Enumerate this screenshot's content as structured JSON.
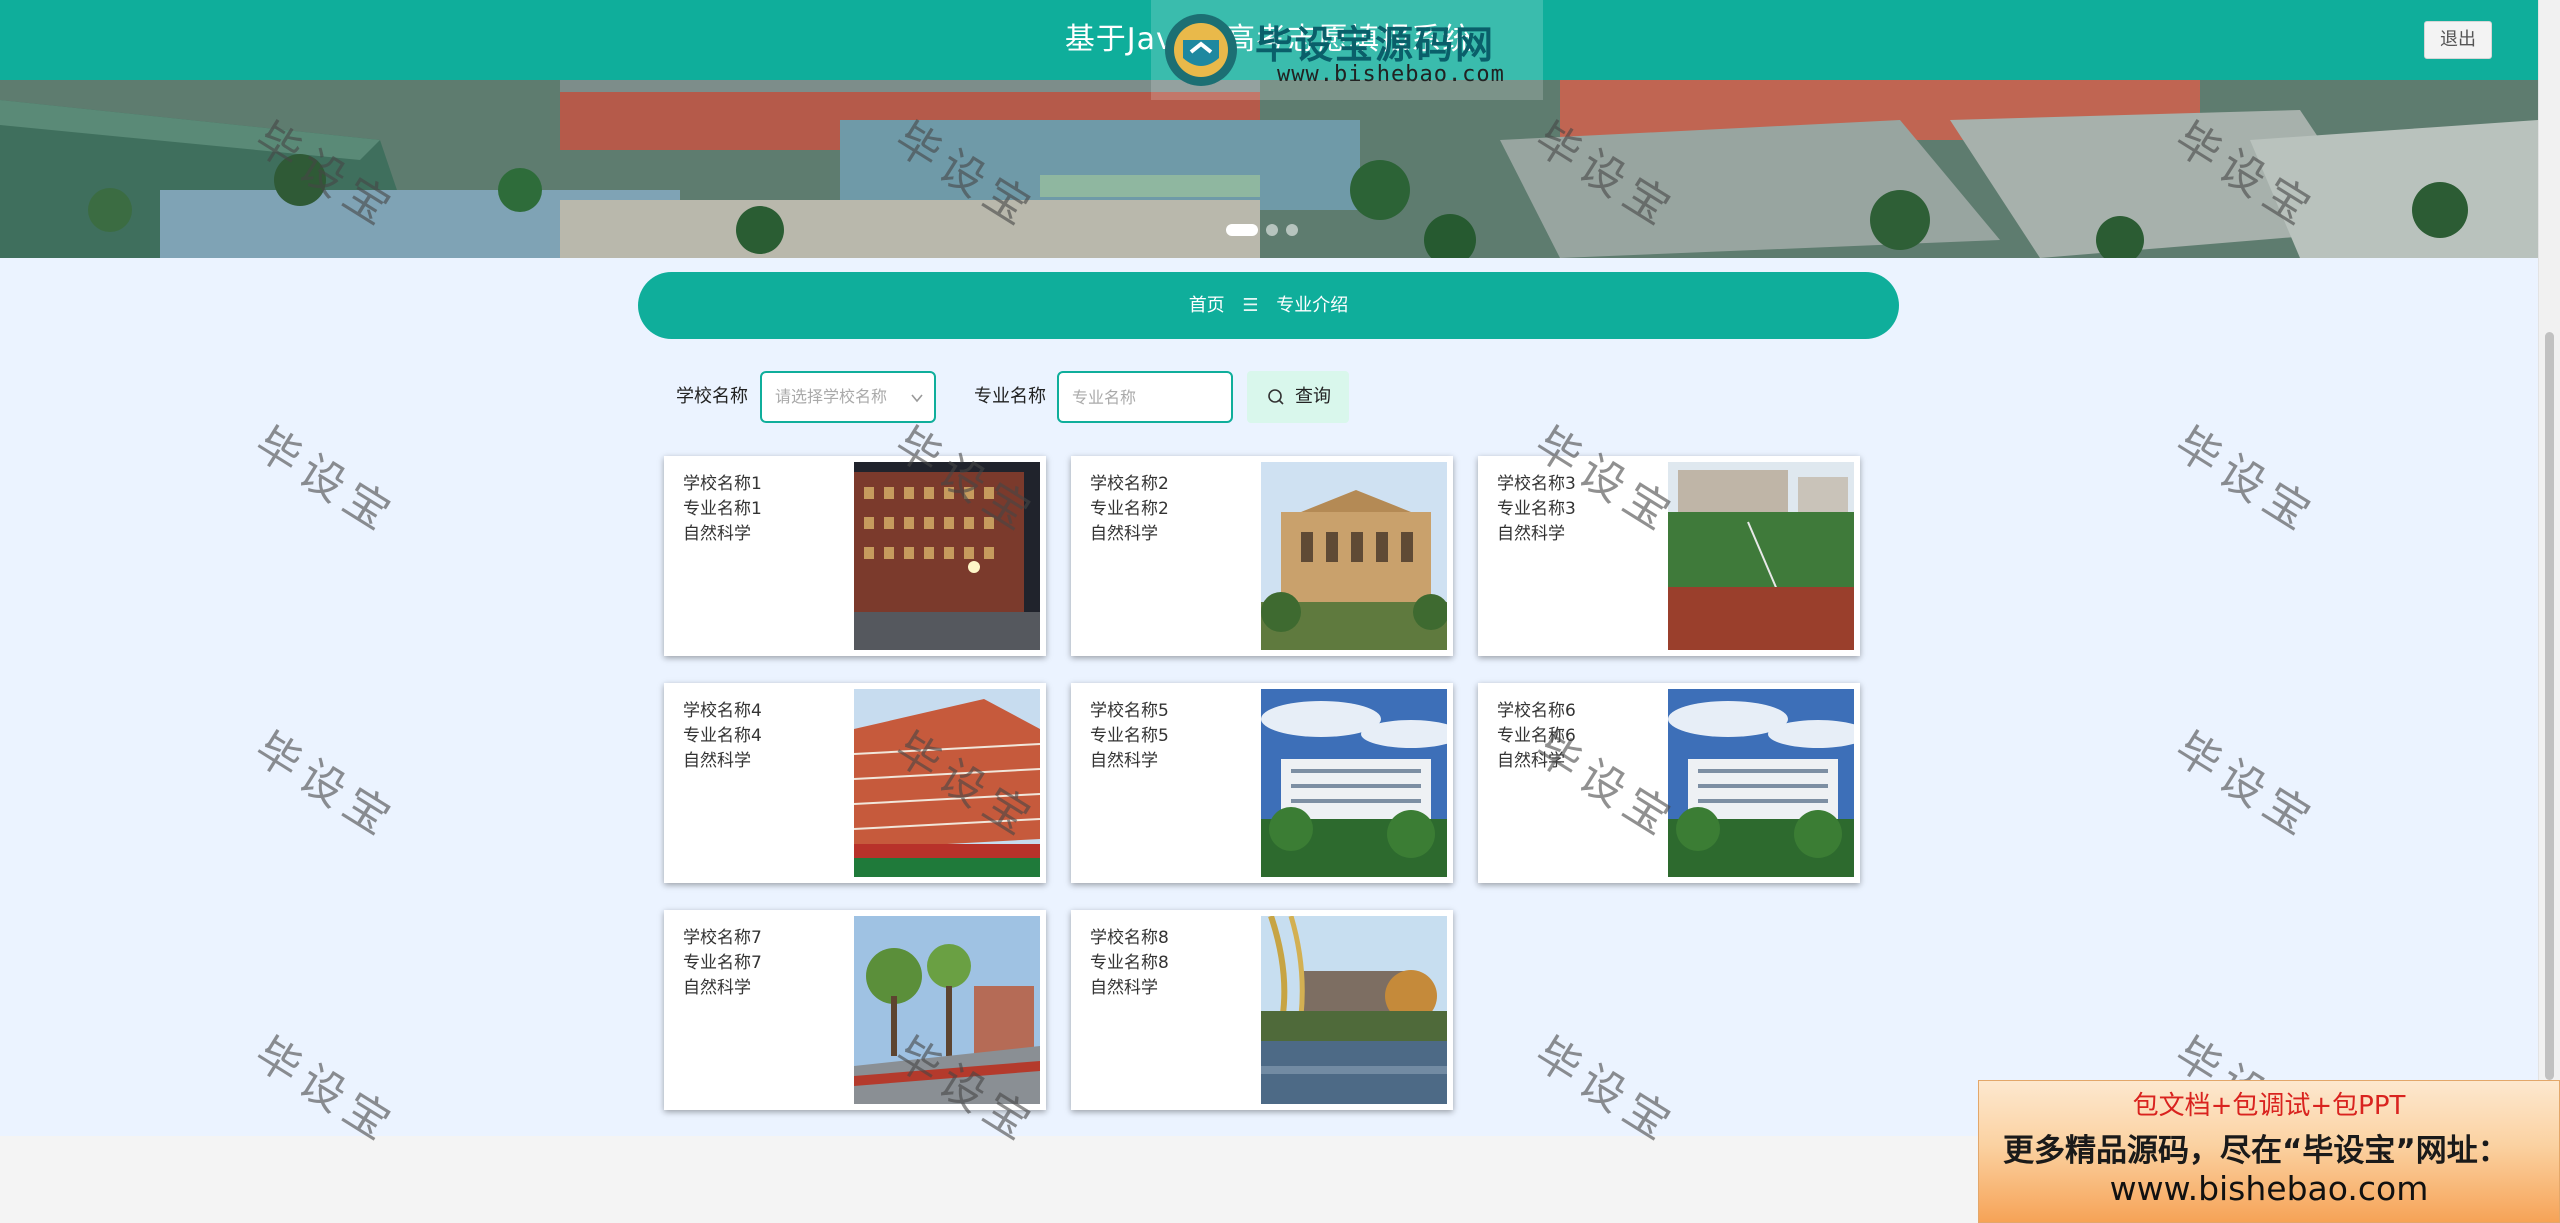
{
  "header": {
    "title": "基于Java的高考志愿填报系统",
    "logout_label": "退出"
  },
  "logo": {
    "title": "毕设宝源码网",
    "url": "www.bishebao.com"
  },
  "banner": {
    "slide_count": 3,
    "active_slide": 1
  },
  "breadcrumb": {
    "home": "首页",
    "separator": "☰",
    "current": "专业介绍"
  },
  "search": {
    "school_label": "学校名称",
    "school_placeholder": "请选择学校名称",
    "major_label": "专业名称",
    "major_placeholder": "专业名称",
    "query_label": "查询"
  },
  "cards": [
    {
      "school": "学校名称1",
      "major": "专业名称1",
      "category": "自然科学",
      "photo": "night-building"
    },
    {
      "school": "学校名称2",
      "major": "专业名称2",
      "category": "自然科学",
      "photo": "classical-building"
    },
    {
      "school": "学校名称3",
      "major": "专业名称3",
      "category": "自然科学",
      "photo": "sports-field"
    },
    {
      "school": "学校名称4",
      "major": "专业名称4",
      "category": "自然科学",
      "photo": "red-building"
    },
    {
      "school": "学校名称5",
      "major": "专业名称5",
      "category": "自然科学",
      "photo": "white-building-blue-sky"
    },
    {
      "school": "学校名称6",
      "major": "专业名称6",
      "category": "自然科学",
      "photo": "white-building-blue-sky"
    },
    {
      "school": "学校名称7",
      "major": "专业名称7",
      "category": "自然科学",
      "photo": "tree-lined-walkway"
    },
    {
      "school": "学校名称8",
      "major": "专业名称8",
      "category": "自然科学",
      "photo": "lake-willow"
    }
  ],
  "watermark": {
    "text": "毕设宝"
  },
  "ad": {
    "line1": "包文档+包调试+包PPT",
    "line2": "更多精品源码，尽在“毕设宝”网址：",
    "line3": "www.bishebao.com"
  },
  "colors": {
    "primary": "#0fae9b",
    "page_background": "#ebf3ff",
    "query_button": "#d9f7ec"
  }
}
